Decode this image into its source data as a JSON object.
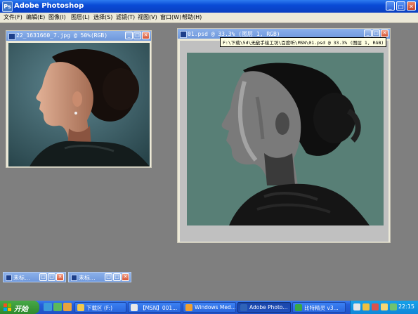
{
  "app": {
    "title": "Adobe Photoshop",
    "icon": "photoshop-app-icon"
  },
  "menu": {
    "items": [
      "文件(F)",
      "编辑(E)",
      "图像(I)",
      "图层(L)",
      "选择(S)",
      "滤镜(T)",
      "视图(V)",
      "窗口(W)",
      "帮助(H)"
    ]
  },
  "documents": [
    {
      "title": "22_1631660_7.jpg @ 50%(RGB)"
    },
    {
      "title": "01.psd @ 33.3% (图层 1, RGB)"
    }
  ],
  "tooltip": {
    "text": "F:\\下载\\5d\\无敌手绘工坊\\百度听\\MSN\\01.psd @ 33.3% (图层 1, RGB)"
  },
  "minimized": [
    {
      "title": "未标..."
    },
    {
      "title": "未标..."
    }
  ],
  "taskbar": {
    "start_label": "开始",
    "tasks": [
      {
        "label": "下载区 (F:)",
        "icon_color": "#f2c94c"
      },
      {
        "label": "【MSN】001...",
        "icon_color": "#e8e8e8"
      },
      {
        "label": "Windows Med...",
        "icon_color": "#f0a030"
      },
      {
        "label": "Adobe Photo...",
        "icon_color": "#2f63b8",
        "active": true
      },
      {
        "label": "比特精灵 v3...",
        "icon_color": "#39a845"
      }
    ],
    "clock": "22:15"
  },
  "colors": {
    "workspace": "#7f7f7f",
    "titlebar": "#0a4bd6",
    "doc_bg_green": "#5e8477",
    "doc_bg_teal": "#587f7d"
  }
}
